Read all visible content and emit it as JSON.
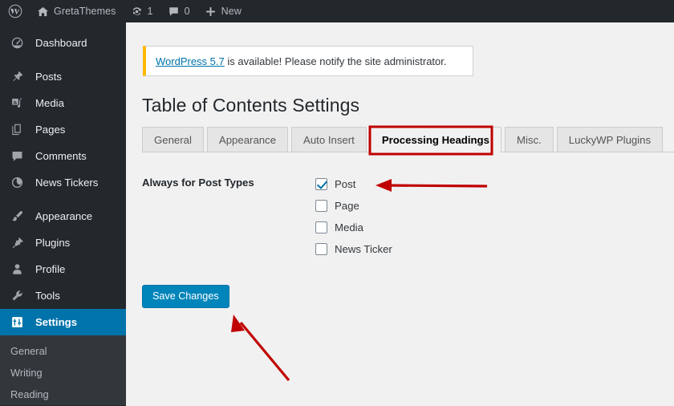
{
  "adminbar": {
    "items": [
      {
        "name": "wordpress-logo",
        "icon": "wordpress-icon",
        "label": ""
      },
      {
        "name": "site-name",
        "icon": "home-icon",
        "label": "GretaThemes"
      },
      {
        "name": "updates",
        "icon": "updates-icon",
        "label": "1"
      },
      {
        "name": "comments",
        "icon": "comment-icon",
        "label": "0"
      },
      {
        "name": "new-content",
        "icon": "plus-icon",
        "label": "New"
      }
    ]
  },
  "sidebar": {
    "items": [
      {
        "label": "Dashboard",
        "icon": "dashboard-icon",
        "current": false
      },
      {
        "label": "Posts",
        "icon": "pin-icon",
        "current": false
      },
      {
        "label": "Media",
        "icon": "media-icon",
        "current": false
      },
      {
        "label": "Pages",
        "icon": "pages-icon",
        "current": false
      },
      {
        "label": "Comments",
        "icon": "comment-icon",
        "current": false
      },
      {
        "label": "News Tickers",
        "icon": "ticker-icon",
        "current": false
      },
      {
        "label": "Appearance",
        "icon": "brush-icon",
        "current": false
      },
      {
        "label": "Plugins",
        "icon": "plugin-icon",
        "current": false
      },
      {
        "label": "Profile",
        "icon": "user-icon",
        "current": false
      },
      {
        "label": "Tools",
        "icon": "wrench-icon",
        "current": false
      },
      {
        "label": "Settings",
        "icon": "settings-icon",
        "current": true
      }
    ],
    "submenu": [
      {
        "label": "General"
      },
      {
        "label": "Writing"
      },
      {
        "label": "Reading"
      }
    ]
  },
  "notice": {
    "link_text": "WordPress 5.7",
    "message": " is available! Please notify the site administrator.",
    "accent_color": "#ffb900"
  },
  "main": {
    "page_title": "Table of Contents Settings",
    "tabs": [
      {
        "label": "General",
        "active": false
      },
      {
        "label": "Appearance",
        "active": false
      },
      {
        "label": "Auto Insert",
        "active": false
      },
      {
        "label": "Processing Headings",
        "active": true
      },
      {
        "label": "Misc.",
        "active": false
      },
      {
        "label": "LuckyWP Plugins",
        "active": false
      }
    ],
    "form": {
      "label": "Always for Post Types",
      "options": [
        {
          "label": "Post",
          "checked": true
        },
        {
          "label": "Page",
          "checked": false
        },
        {
          "label": "Media",
          "checked": false
        },
        {
          "label": "News Ticker",
          "checked": false
        }
      ]
    },
    "save_label": "Save Changes"
  },
  "annotations": {
    "highlight_color": "#c00000",
    "arrow_to_post_checkbox": "arrow-left",
    "arrow_to_save_button": "arrow-up-left",
    "highlight_box_target": "Processing Headings"
  },
  "colors": {
    "admin_dark": "#23282d",
    "submenu_dark": "#32373c",
    "accent_blue": "#0073aa",
    "button_blue": "#0085ba",
    "content_bg": "#f1f1f1",
    "annotation_red": "#c00000"
  }
}
